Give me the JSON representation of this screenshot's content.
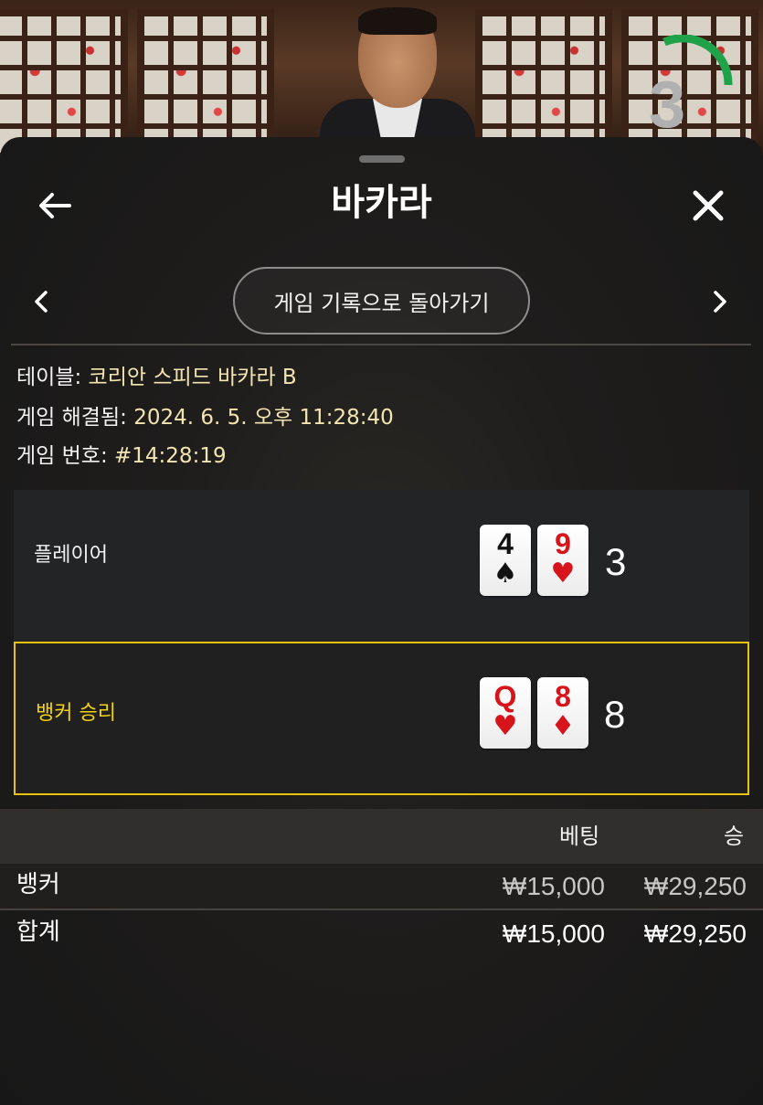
{
  "video": {
    "countdown": "3",
    "timer_color": "#1fa24a"
  },
  "sheet": {
    "title": "바카라",
    "history_button": "게임 기록으로 돌아가기"
  },
  "info": {
    "table_label": "테이블:",
    "table_value": "코리안 스피드 바카라 B",
    "resolved_label": "게임 해결됨:",
    "resolved_value": "2024. 6. 5. 오후 11:28:40",
    "number_label": "게임 번호:",
    "number_value": "#14:28:19"
  },
  "results": {
    "player": {
      "label": "플레이어",
      "cards": [
        {
          "rank": "4",
          "suit": "♠",
          "color": "black"
        },
        {
          "rank": "9",
          "suit": "♥",
          "color": "red"
        }
      ],
      "score": "3"
    },
    "banker": {
      "label": "뱅커 승리",
      "cards": [
        {
          "rank": "Q",
          "suit": "♥",
          "color": "red"
        },
        {
          "rank": "8",
          "suit": "♦",
          "color": "red"
        }
      ],
      "score": "8"
    }
  },
  "bets": {
    "headers": {
      "bet": "베팅",
      "win": "승"
    },
    "rows": [
      {
        "name": "뱅커",
        "bet": "₩15,000",
        "win": "₩29,250"
      },
      {
        "name": "합계",
        "bet": "₩15,000",
        "win": "₩29,250"
      }
    ]
  },
  "colors": {
    "accent_gold": "#e7c30d",
    "info_value": "#f3e5b0"
  },
  "icons": {
    "back": "arrow-left-icon",
    "close": "close-icon",
    "prev": "chevron-left-icon",
    "next": "chevron-right-icon"
  }
}
